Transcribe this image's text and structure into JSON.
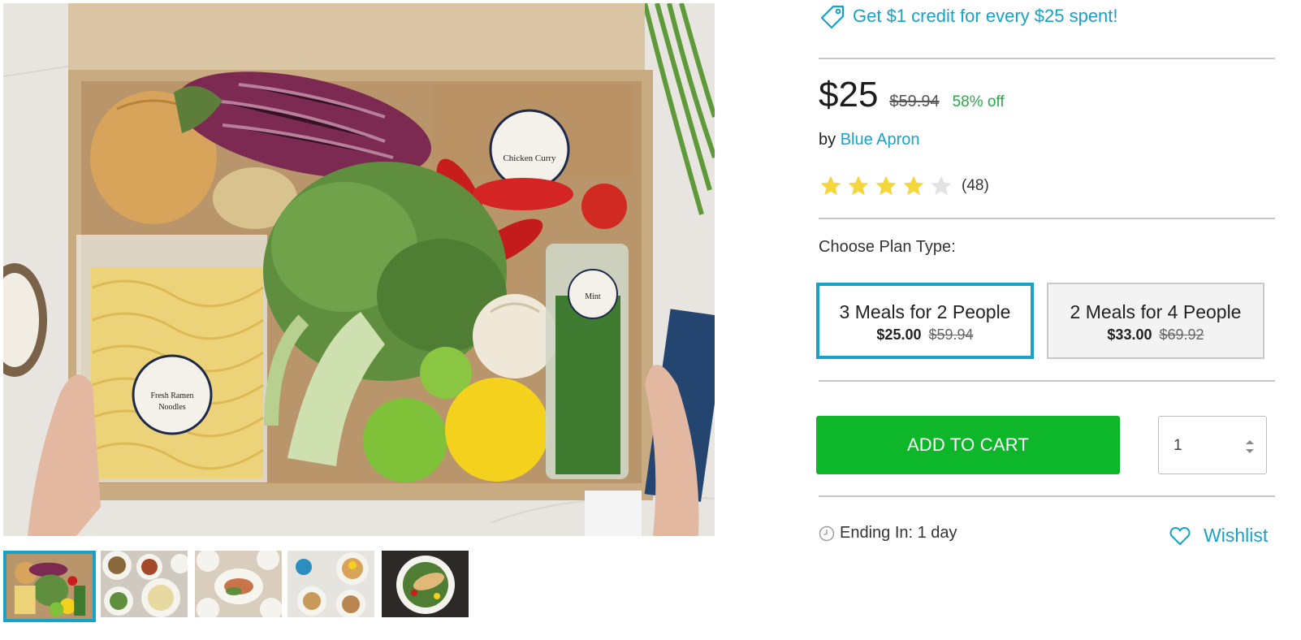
{
  "gallery": {
    "main_image": "meal-kit-box-photo",
    "thumbnails": [
      {
        "name": "meal-kit-box-thumb",
        "active": true
      },
      {
        "name": "plated-meals-thumb",
        "active": false
      },
      {
        "name": "plated-fish-dish-thumb",
        "active": false
      },
      {
        "name": "ramen-bowls-thumb",
        "active": false
      },
      {
        "name": "chicken-salad-bowl-thumb",
        "active": false
      }
    ]
  },
  "promo": {
    "icon": "tag-icon",
    "text": "Get $1 credit for every $25 spent!"
  },
  "price": {
    "current": "$25",
    "original": "$59.94",
    "discount": "58% off"
  },
  "seller": {
    "prefix": "by",
    "brand": "Blue Apron"
  },
  "rating": {
    "stars": 4,
    "max_stars": 5,
    "count": "(48)"
  },
  "plans": {
    "label": "Choose Plan Type:",
    "options": [
      {
        "name": "3 Meals for 2 People",
        "price": "$25.00",
        "original": "$59.94",
        "selected": true
      },
      {
        "name": "2 Meals for 4 People",
        "price": "$33.00",
        "original": "$69.92",
        "selected": false
      }
    ]
  },
  "cart": {
    "button_label": "ADD TO CART",
    "quantity": "1"
  },
  "ending": {
    "icon": "clock-icon",
    "text": "Ending In: 1 day"
  },
  "wishlist": {
    "icon": "heart-icon",
    "label": "Wishlist"
  },
  "colors": {
    "accent": "#16a2c9",
    "cta_green": "#0eb72a",
    "discount_green": "#2aa84a",
    "star_yellow": "#f5d63a",
    "star_empty": "#e3e3e3"
  }
}
